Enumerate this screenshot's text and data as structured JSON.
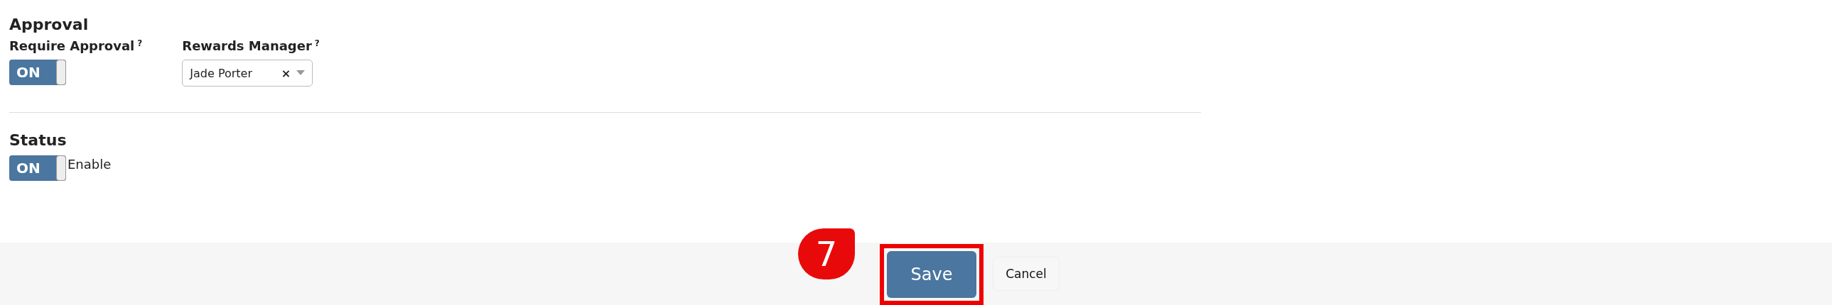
{
  "approval": {
    "heading": "Approval",
    "require_approval": {
      "label": "Require Approval",
      "help": "?",
      "toggle": {
        "label": "ON",
        "on": true
      }
    },
    "rewards_manager": {
      "label": "Rewards Manager",
      "help": "?",
      "value": "Jade Porter",
      "clear": "×"
    }
  },
  "status": {
    "heading": "Status",
    "toggle": {
      "label": "ON",
      "on": true
    },
    "caption": "Enable"
  },
  "footer": {
    "callout": "7",
    "buttons": [
      {
        "label": "Save",
        "kind": "primary",
        "highlighted": true
      },
      {
        "label": "Cancel",
        "kind": "secondary",
        "highlighted": false
      }
    ]
  }
}
